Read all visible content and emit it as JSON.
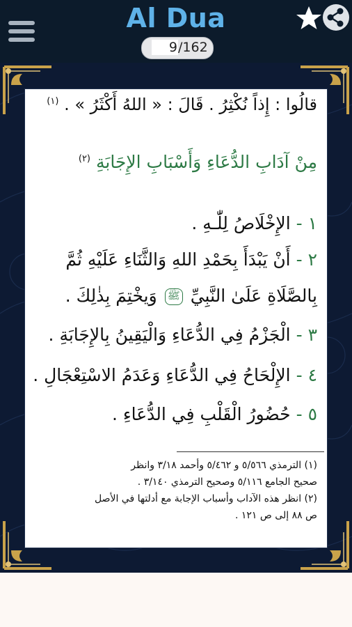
{
  "app": {
    "title": "Al Dua",
    "current_page": "9",
    "page_separator": "/162"
  },
  "icons": {
    "menu": "hamburger-menu-icon",
    "favorite": "star-icon",
    "share": "share-icon"
  },
  "content": {
    "quote_line": "قالُوا : إِذاً نُكْثِرُ . قَالَ : « اللهُ أَكْثَرُ » .",
    "quote_footnote_ref": "(١)",
    "heading": "مِنْ آدَابِ الدُّعَاءِ وَأَسْبَابِ الإِجَابَةِ",
    "heading_footnote_ref": "(٢)",
    "items": [
      {
        "num": "١",
        "text": "الإِخْلَاصُ لِلّٰـهِ ."
      },
      {
        "num": "٢",
        "text": "أَنْ يَبْدَأَ بِحَمْدِ اللهِ وَالثَّنَاءِ عَلَيْهِ ثُمَّ"
      },
      {
        "num": "",
        "text_before": "بِالصَّلَاةِ عَلَىٰ النَّبِيِّ",
        "salla": "ﷺ",
        "text_after": "وَيخْتِمَ بِذٰلِكَ ."
      },
      {
        "num": "٣",
        "text": "الْجَزْمُ فِي الدُّعَاءِ وَالْيَقِينُ بِالإِجَابَةِ ."
      },
      {
        "num": "٤",
        "text": "الإِلْحَاحُ فِي الدُّعَاءِ وَعَدَمُ الاسْتِعْجَالِ ."
      },
      {
        "num": "٥",
        "text": "حُضُورُ الْقَلْبِ فِي الدُّعَاءِ ."
      }
    ],
    "footnotes": [
      "(١) الترمذي ٥/٥٦٦ و ٥/٤٦٢ وأحمد ٣/١٨ وانظر",
      "صحيح الجامع ٥/١١٦ وصحيح الترمذي ٣/١٤٠ .",
      "(٢) انظر هذه الآداب وأسباب الإجابة مع أدلتها في الأصل",
      "ص ٨٨ إلى ص ١٢١ ."
    ]
  },
  "colors": {
    "header_bg": "#0c1b2b",
    "title": "#5fb2e8",
    "frame_bg": "#0d1a33",
    "gold": "#c9a24a",
    "heading_green": "#2d7a45"
  }
}
